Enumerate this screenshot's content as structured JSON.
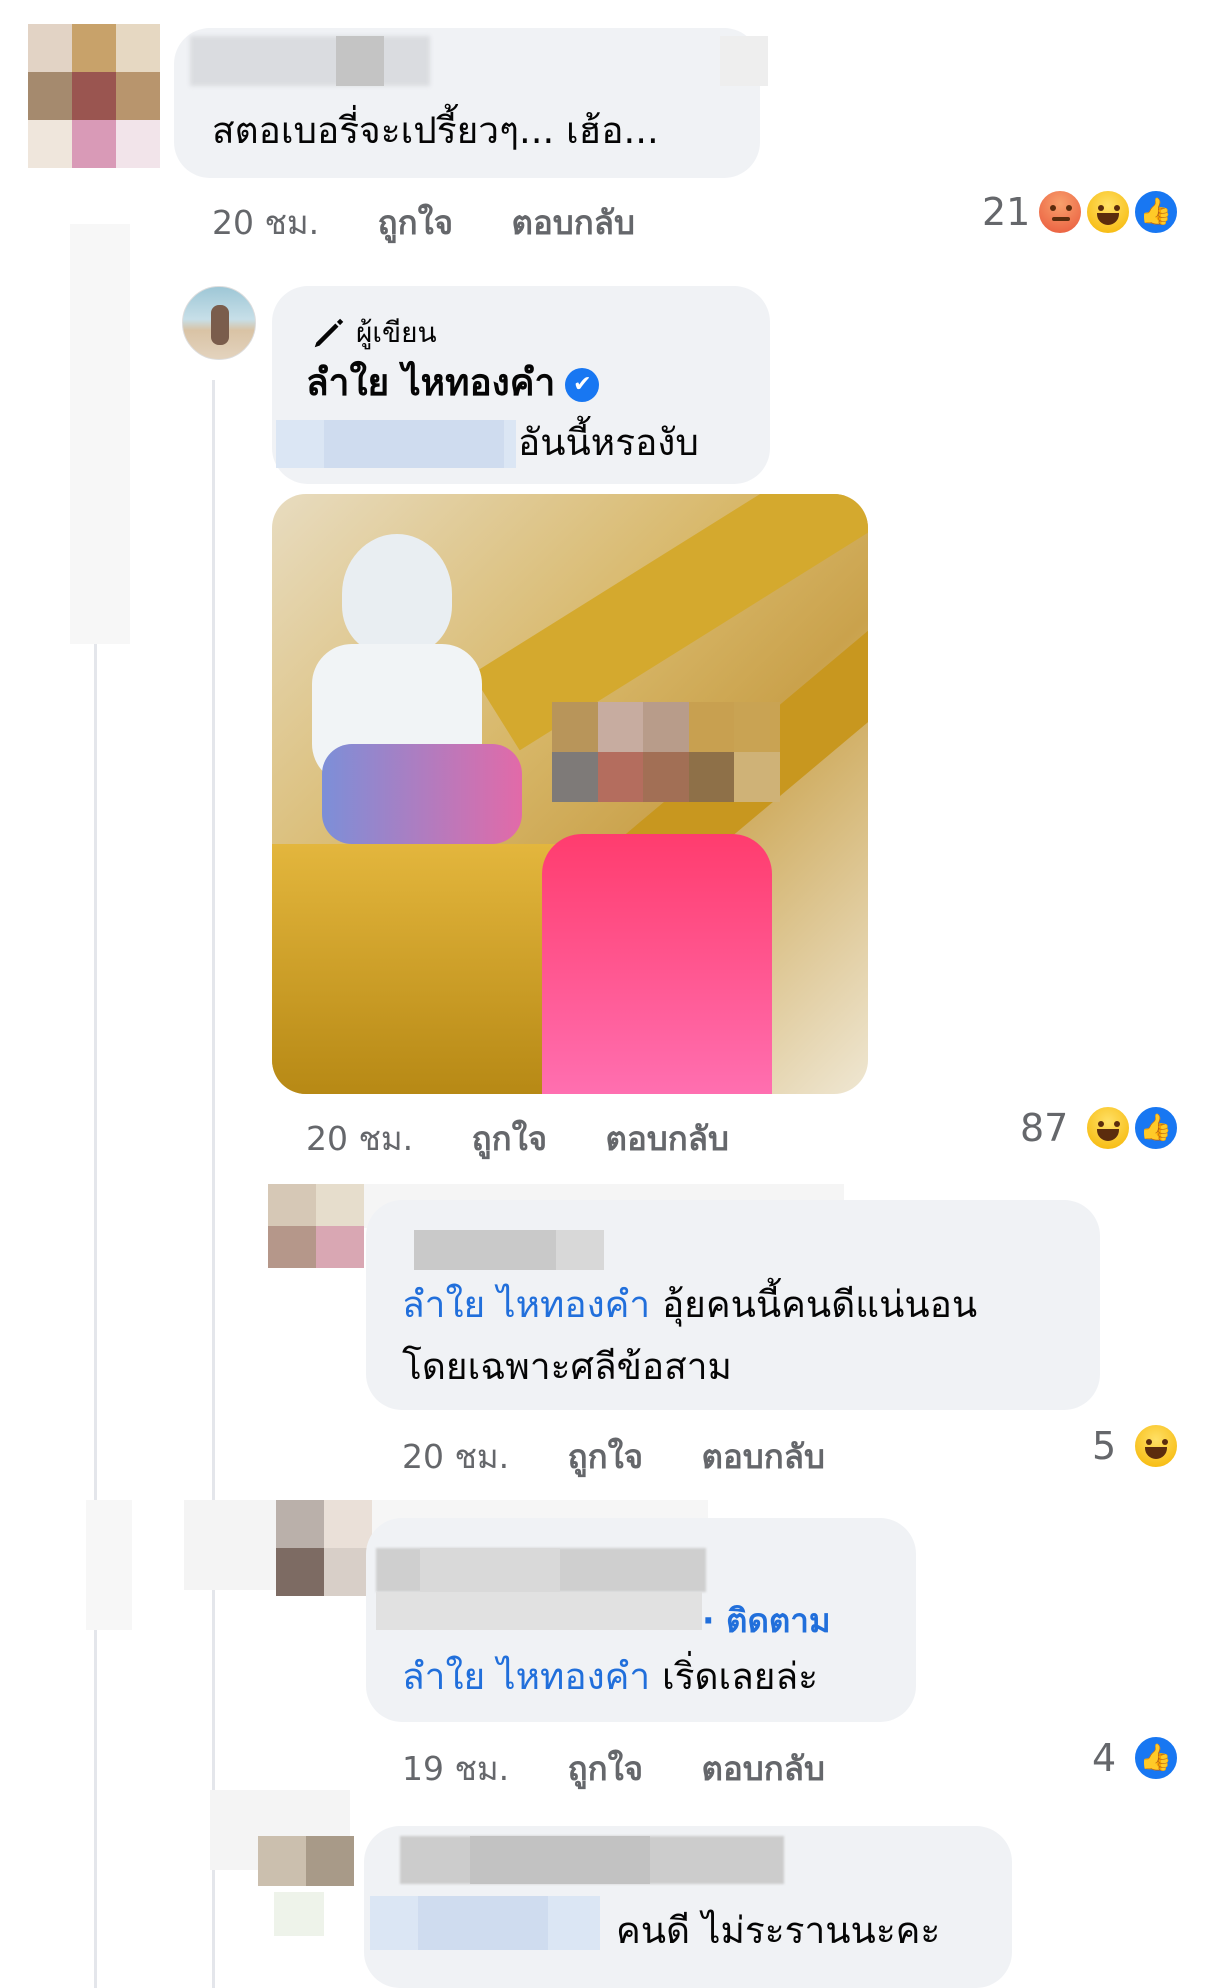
{
  "comment1": {
    "text": "สตอเบอรี่จะเปรี้ยวๆ... เฮ้อ...",
    "time": "20 ชม.",
    "like": "ถูกใจ",
    "reply": "ตอบกลับ",
    "reaction_count": "21"
  },
  "comment2": {
    "badge_icon": "pencil-icon",
    "badge": "ผู้เขียน",
    "author": "ลำใย ไหทองคำ",
    "verified_icon": "verified-icon",
    "text": "อันนี้หรองับ",
    "time": "20 ชม.",
    "like": "ถูกใจ",
    "reply": "ตอบกลับ",
    "reaction_count": "87"
  },
  "comment3": {
    "mention": "ลำใย ไหทองคำ",
    "text_line1": "อุ้ยคนนี้คนดีแน่นอน",
    "text_line2": "โดยเฉพาะศลีข้อสาม",
    "time": "20 ชม.",
    "like": "ถูกใจ",
    "reply": "ตอบกลับ",
    "reaction_count": "5"
  },
  "comment4": {
    "follow": "· ติดตาม",
    "mention": "ลำใย ไหทองคำ",
    "text": "เริ่ดเลยล่ะ",
    "time": "19 ชม.",
    "like": "ถูกใจ",
    "reply": "ตอบกลับ",
    "reaction_count": "4"
  },
  "comment5": {
    "text": "คนดี ไม่ระรานนะคะ"
  },
  "colors": {
    "bubble": "#f0f2f5",
    "meta": "#65676b",
    "mention": "#216fdb",
    "like_blue": "#1877f2"
  }
}
